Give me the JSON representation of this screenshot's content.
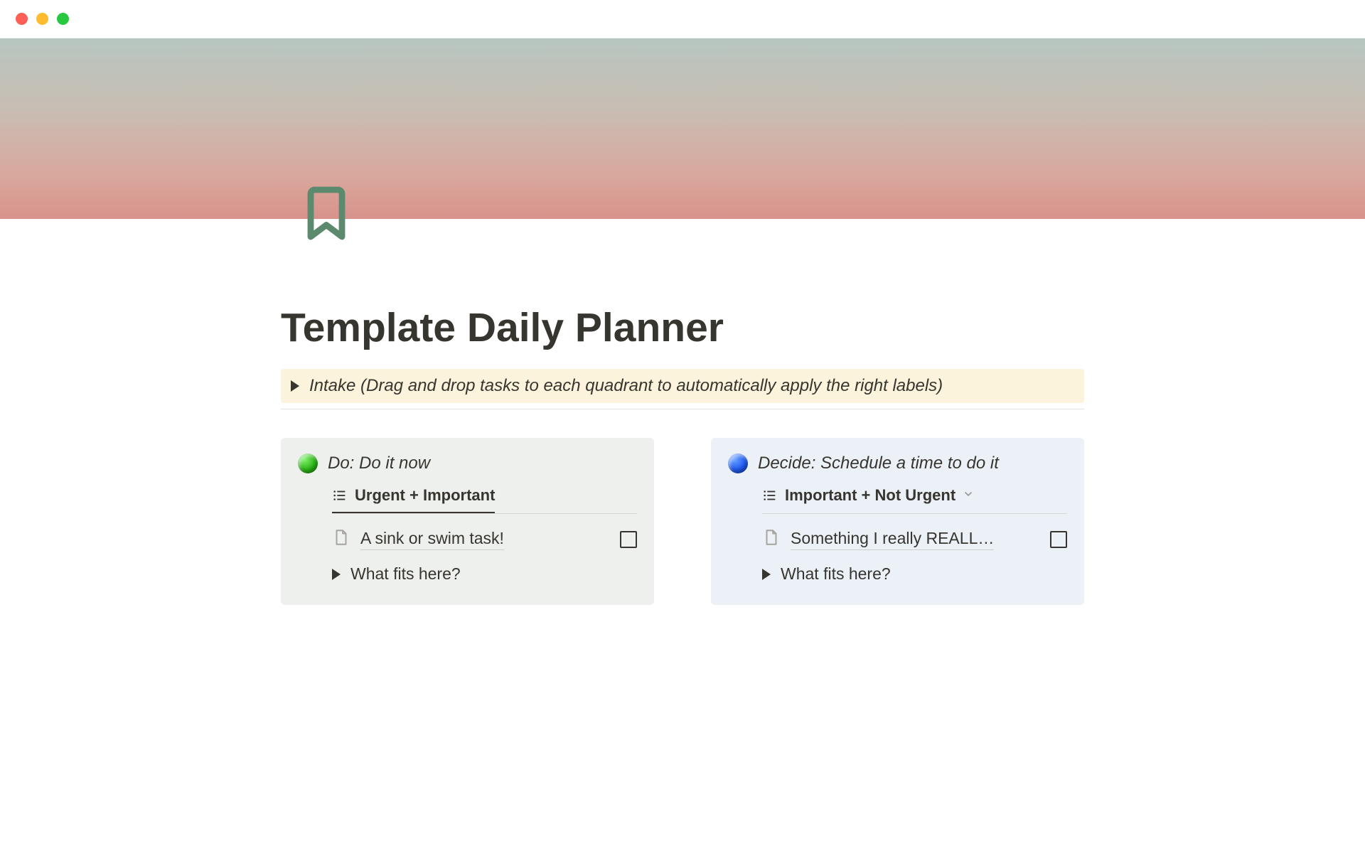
{
  "page": {
    "title": "Template Daily Planner"
  },
  "callout": {
    "text": "Intake (Drag and drop tasks to each quadrant to automatically apply the right labels)"
  },
  "quadrants": {
    "do": {
      "title": "Do: Do it now",
      "view_label": "Urgent + Important",
      "task": "A sink or swim task!",
      "fits": "What fits here?"
    },
    "decide": {
      "title": "Decide: Schedule a time to do it",
      "view_label": "Important + Not Urgent",
      "task": "Something I really REALL…",
      "fits": "What fits here?"
    }
  }
}
